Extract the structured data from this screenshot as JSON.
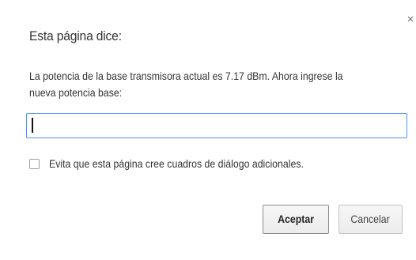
{
  "dialog": {
    "title": "Esta página dice:",
    "message": "La potencia de la base transmisora actual es 7.17 dBm. Ahora ingrese la nueva potencia base:",
    "input_value": "",
    "checkbox_label": "Evita que esta página cree cuadros de diálogo adicionales.",
    "checkbox_checked": false,
    "close_symbol": "×",
    "buttons": {
      "accept": "Aceptar",
      "cancel": "Cancelar"
    }
  },
  "colors": {
    "input_focus_border": "#4d90fe",
    "text": "#333333"
  }
}
